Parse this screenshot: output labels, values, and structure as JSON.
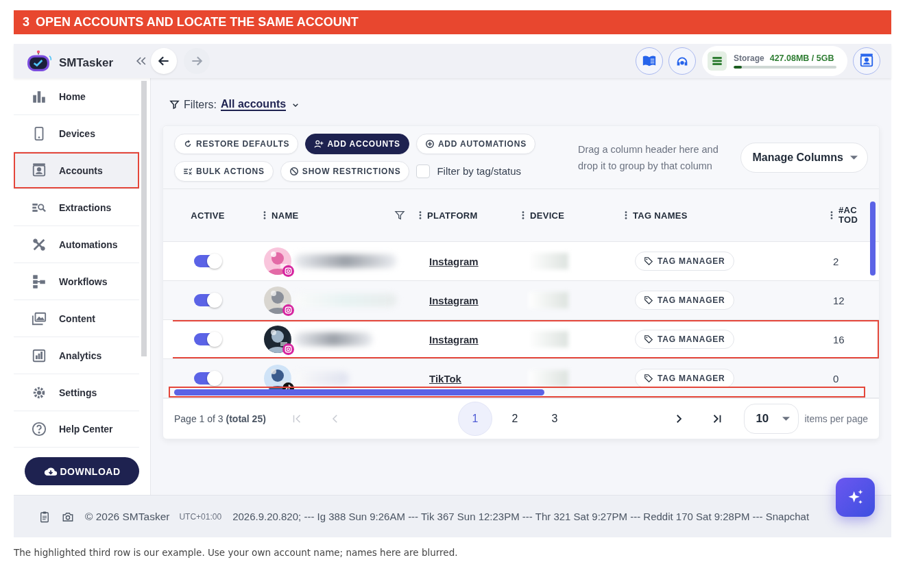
{
  "banner": {
    "number": "3",
    "title": "OPEN ACCOUNTS AND LOCATE THE SAME ACCOUNT"
  },
  "app": {
    "name": "SMTasker"
  },
  "topbar": {
    "storage": {
      "label": "Storage",
      "value": "427.08MB / 5GB",
      "level": 0.08
    }
  },
  "sidebar": {
    "items": [
      {
        "label": "Home",
        "selected": false,
        "highlighted": false
      },
      {
        "label": "Devices",
        "selected": false,
        "highlighted": false
      },
      {
        "label": "Accounts",
        "selected": true,
        "highlighted": true
      },
      {
        "label": "Extractions",
        "selected": false,
        "highlighted": false
      },
      {
        "label": "Automations",
        "selected": false,
        "highlighted": false
      },
      {
        "label": "Workflows",
        "selected": false,
        "highlighted": false
      },
      {
        "label": "Content",
        "selected": false,
        "highlighted": false
      },
      {
        "label": "Analytics",
        "selected": false,
        "highlighted": false
      },
      {
        "label": "Settings",
        "selected": false,
        "highlighted": false
      }
    ],
    "help": "Help Center",
    "download": "DOWNLOAD"
  },
  "filters": {
    "label": "Filters:",
    "value": "All accounts"
  },
  "toolbar": {
    "buttons": [
      {
        "label": "RESTORE DEFAULTS",
        "primary": false
      },
      {
        "label": "ADD ACCOUNTS",
        "primary": true
      },
      {
        "label": "ADD AUTOMATIONS",
        "primary": false
      },
      {
        "label": "BULK ACTIONS",
        "primary": false
      },
      {
        "label": "SHOW RESTRICTIONS",
        "primary": false
      }
    ],
    "filter_checkbox": {
      "label": "Filter by tag/status",
      "checked": false
    },
    "group_hint": "Drag a column header here and drop it to group by that column",
    "manage_columns": "Manage Columns"
  },
  "table": {
    "columns": [
      {
        "label": "ACTIVE",
        "kind": "active",
        "menu": false,
        "filter": false
      },
      {
        "label": "NAME",
        "kind": "name",
        "menu": true,
        "filter": true
      },
      {
        "label": "PLATFORM",
        "kind": "platform",
        "menu": true,
        "filter": false
      },
      {
        "label": "DEVICE",
        "kind": "device",
        "menu": true,
        "filter": false
      },
      {
        "label": "TAG NAMES",
        "kind": "tags",
        "menu": true,
        "filter": false
      },
      {
        "label": "#AC TOD",
        "kind": "count",
        "menu": true,
        "filter": false
      }
    ],
    "rows": [
      {
        "kind": "instagram",
        "active": true,
        "platform": "Instagram",
        "tag_button": "TAG MANAGER",
        "column_6": "2",
        "highlighted": false
      },
      {
        "kind": "instagram",
        "active": true,
        "platform": "Instagram",
        "tag_button": "TAG MANAGER",
        "column_6": "12",
        "highlighted": false
      },
      {
        "kind": "instagram",
        "active": true,
        "platform": "Instagram",
        "tag_button": "TAG MANAGER",
        "column_6": "16",
        "highlighted": true
      },
      {
        "kind": "tiktok",
        "active": true,
        "platform": "TikTok",
        "tag_button": "TAG MANAGER",
        "column_6": "0",
        "highlighted": false
      }
    ],
    "horizontal_scrollbar": {
      "highlighted": true
    }
  },
  "pagination": {
    "summary": "Page 1 of 3 **(total 25)**",
    "pages": [
      {
        "label": "1",
        "selected": true
      },
      {
        "label": "2",
        "selected": false
      },
      {
        "label": "3",
        "selected": false
      }
    ],
    "page_size": "10",
    "page_size_label": "items per page"
  },
  "footer": {
    "copyright": "© 2026 SMTasker",
    "timezone": "UTC+01:00",
    "status": "2026.9.20.820; --- Ig 388 Sun 9:26AM --- Tik 367 Sun 12:23PM --- Thr 321 Sat 9:27PM --- Reddit 170 Sat 9:28PM --- Snapchat"
  },
  "caption": "The highlighted third row is our example. Use your own account name; names here are blurred."
}
